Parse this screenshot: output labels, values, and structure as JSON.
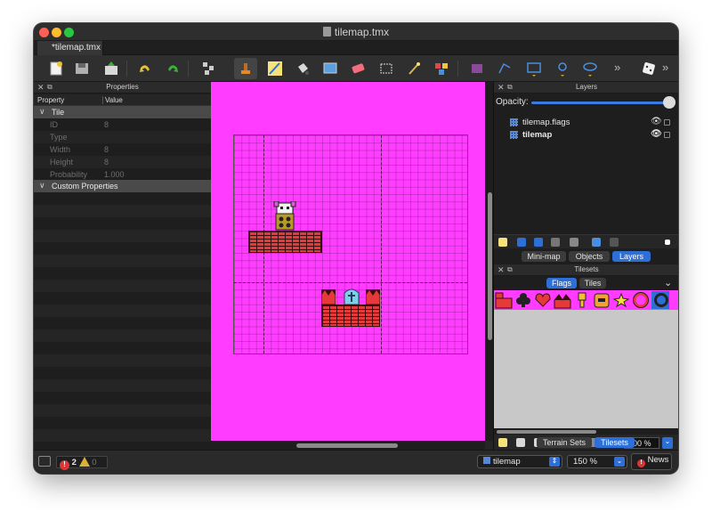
{
  "window": {
    "title": "tilemap.tmx",
    "tab_label": "*tilemap.tmx"
  },
  "toolbar": {
    "icons": [
      "new-icon",
      "save-icon",
      "export-icon",
      "undo-icon",
      "redo-icon",
      "stamp-brush-icon",
      "terrain-brush-icon",
      "bucket-fill-icon",
      "shape-fill-icon",
      "eraser-icon",
      "rect-select-icon",
      "magic-wand-icon",
      "select-same-icon",
      "rect-object-icon",
      "polygon-icon",
      "tile-object-icon",
      "point-object-icon",
      "ellipse-object-icon",
      "more-icon",
      "random-mode-icon"
    ]
  },
  "properties": {
    "panel_title": "Properties",
    "col_property": "Property",
    "col_value": "Value",
    "group_tile": "Tile",
    "rows": [
      {
        "key": "ID",
        "value": "8"
      },
      {
        "key": "Type",
        "value": ""
      },
      {
        "key": "Width",
        "value": "8"
      },
      {
        "key": "Height",
        "value": "8"
      },
      {
        "key": "Probability",
        "value": "1.000"
      }
    ],
    "group_custom": "Custom Properties"
  },
  "layers": {
    "panel_title": "Layers",
    "opacity_label": "Opacity:",
    "opacity": 1.0,
    "items": [
      {
        "name": "tilemap.flags",
        "bold": false
      },
      {
        "name": "tilemap",
        "bold": true
      }
    ],
    "tabs": [
      "Mini-map",
      "Objects",
      "Layers"
    ],
    "selected_tab": "Layers"
  },
  "tilesets": {
    "panel_title": "Tilesets",
    "tabs": [
      "Flags",
      "Tiles"
    ],
    "selected_tab": "Flags",
    "zoom": "400 %",
    "bottom_tabs": [
      "Terrain Sets",
      "Tilesets"
    ],
    "selected_bottom_tab": "Tilesets"
  },
  "status": {
    "errors": "2",
    "warnings": "0",
    "layer_select": "tilemap",
    "zoom": "150 %",
    "news": "News"
  },
  "colors": {
    "map_bg": "#ff3cff",
    "brick": "#e63a3a",
    "accent": "#2d6fd7"
  }
}
